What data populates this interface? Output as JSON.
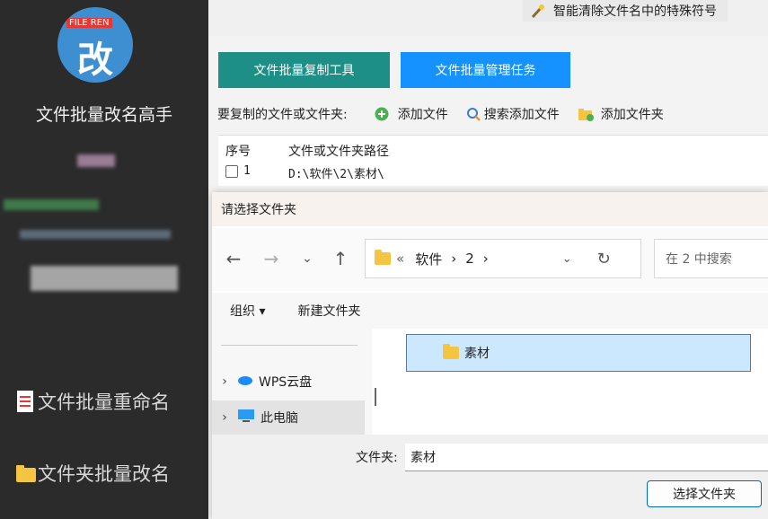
{
  "sidebar": {
    "logo_tag": "FILE REN",
    "logo_char": "改",
    "app_title": "文件批量改名高手",
    "items": [
      {
        "label": "文件批量重命名",
        "icon": "document-icon"
      },
      {
        "label": "文件夹批量改名",
        "icon": "folder-icon"
      }
    ]
  },
  "top": {
    "smart_clean_label": "智能清除文件名中的特殊符号"
  },
  "tabs": [
    {
      "label": "文件批量复制工具",
      "color": "#1e8f87",
      "active": true
    },
    {
      "label": "文件批量管理任务",
      "color": "#1592ff",
      "active": false
    }
  ],
  "toolbar": {
    "label": "要复制的文件或文件夹:",
    "add_file": "添加文件",
    "search_add": "搜索添加文件",
    "add_folder": "添加文件夹"
  },
  "table": {
    "headers": [
      "序号",
      "文件或文件夹路径"
    ],
    "rows": [
      {
        "no": "1",
        "path": "D:\\软件\\2\\素材\\"
      }
    ]
  },
  "dialog": {
    "title": "请选择文件夹",
    "breadcrumb": [
      "«",
      "软件",
      "›",
      "2",
      "›"
    ],
    "search_placeholder": "在 2 中搜索",
    "organize": "组织 ▾",
    "new_folder": "新建文件夹",
    "nav_items": [
      "WPS云盘",
      "此电脑"
    ],
    "folder_item": "素材",
    "folder_label": "文件夹:",
    "folder_value": "素材",
    "select_button": "选择文件夹"
  }
}
